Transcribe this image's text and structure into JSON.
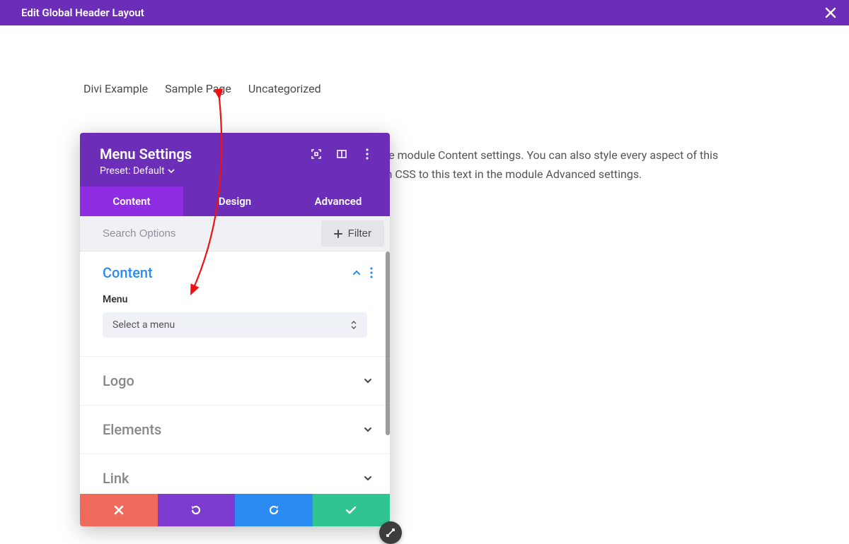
{
  "topbar": {
    "title": "Edit Global Header Layout"
  },
  "nav": {
    "items": [
      "Divi Example",
      "Sample Page",
      "Uncategorized"
    ]
  },
  "page_text": {
    "line1": "Your content goes here. Edit or remove this text inline or in the module Content settings. You can also style every aspect of this",
    "line2": "content in the module Design settings and even apply custom CSS to this text in the module Advanced settings."
  },
  "panel": {
    "title": "Menu Settings",
    "preset": "Preset: Default",
    "tabs": {
      "content": "Content",
      "design": "Design",
      "advanced": "Advanced"
    },
    "search_placeholder": "Search Options",
    "filter_label": "Filter",
    "sections": {
      "content": {
        "title": "Content",
        "menu_label": "Menu",
        "menu_select": "Select a menu"
      },
      "logo": {
        "title": "Logo"
      },
      "elements": {
        "title": "Elements"
      },
      "link": {
        "title": "Link"
      }
    }
  }
}
